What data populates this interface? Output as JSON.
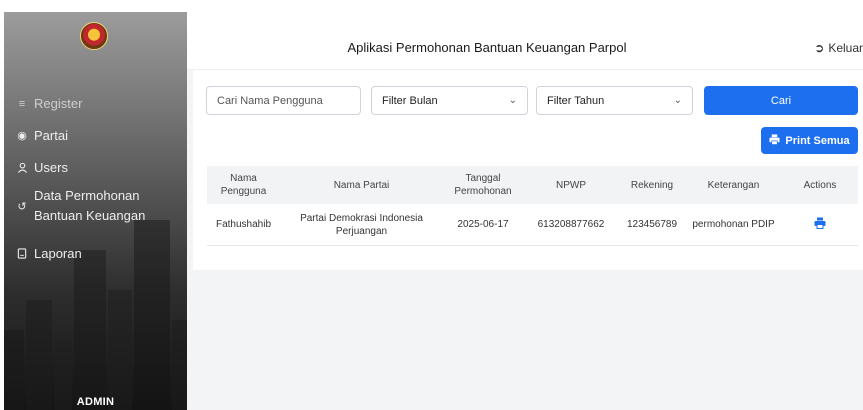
{
  "app": {
    "title": "Aplikasi Permohonan Bantuan Keuangan Parpol",
    "logout_label": "Keluar"
  },
  "sidebar": {
    "items": [
      {
        "label": "Register",
        "icon": "list-icon"
      },
      {
        "label": "Partai",
        "icon": "party-icon"
      },
      {
        "label": "Users",
        "icon": "user-icon"
      },
      {
        "label_line1": "Data Permohonan",
        "label_line2": "Bantuan Keuangan",
        "icon": "arrow-icon"
      },
      {
        "label": "Laporan",
        "icon": "document-icon"
      }
    ],
    "role": "ADMIN"
  },
  "filters": {
    "search_placeholder": "Cari Nama Pengguna",
    "month_label": "Filter Bulan",
    "year_label": "Filter Tahun",
    "search_button": "Cari",
    "print_all_button": "Print Semua"
  },
  "table": {
    "headers": [
      "Nama Pengguna",
      "Nama Partai",
      "Tanggal Permohonan",
      "NPWP",
      "Rekening",
      "Keterangan",
      "Actions"
    ],
    "rows": [
      {
        "nama_pengguna": "Fathushahib",
        "nama_partai": "Partai Demokrasi Indonesia Perjuangan",
        "tanggal": "2025-06-17",
        "npwp": "613208877662",
        "rekening": "123456789",
        "keterangan": "permohonan PDIP"
      }
    ]
  },
  "colors": {
    "accent": "#1e6ff0",
    "header_bg": "#f1f3f5",
    "content_bg": "#f3f4f6"
  }
}
